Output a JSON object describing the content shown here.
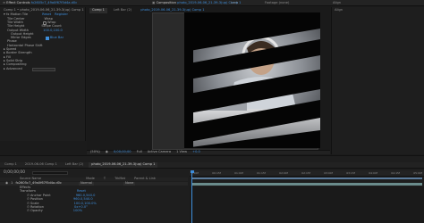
{
  "effect_controls": {
    "tab_label": "Effect Controls",
    "layer_name": "fx2605c7_49a0f67f5d4a.d0c",
    "breadcrumb": "Comp 1 • photo_2019-06-06_21-39-3(up) Comp 1",
    "reset_label": "Reset",
    "register_label": "Register",
    "effects": [
      {
        "name": "fx Motion Tile",
        "indent": 0
      },
      {
        "name": "Tile Center",
        "indent": 1
      },
      {
        "name": "Tile Width",
        "indent": 1
      },
      {
        "name": "Tile Height",
        "indent": 1
      },
      {
        "name": "Output Width",
        "indent": 1
      },
      {
        "name": "Output Height",
        "indent": 1
      },
      {
        "name": "Mirror Edges",
        "indent": 1
      },
      {
        "name": "Phase",
        "indent": 1
      },
      {
        "name": "Horizontal Phase Shift",
        "indent": 1
      },
      {
        "name": "Speed",
        "indent": 0
      },
      {
        "name": "Border Strength",
        "indent": 0
      },
      {
        "name": "Fill",
        "indent": 0
      },
      {
        "name": "Solid Strip",
        "indent": 0
      },
      {
        "name": "Compositing",
        "indent": 0
      },
      {
        "name": "Advanced",
        "indent": 0
      }
    ],
    "options": {
      "wrap_label": "Wrap",
      "line_count_label": "Stripe Count",
      "color_label": "Blue Bar",
      "value_1": "100.0,100.0",
      "value_2": "Wrap"
    }
  },
  "composition": {
    "tab_label": "Composition",
    "comp_name": "photo_2019-06-06_21-39-3(up) Comp 1",
    "tab2_label": "Lock",
    "tab3_label": "Footage (none)",
    "tab4_label": "Align",
    "sub_tabs": [
      "Comp 1",
      "Left Bar (2)",
      "photo_2019-06-06_21-39-3(up) Comp 1"
    ],
    "footer": {
      "zoom": "(50%)",
      "time": "0;00;00;00",
      "resolution": "Full",
      "camera": "Active Camera",
      "view": "1 View",
      "exposure": "+0.0"
    }
  },
  "right_panel": {
    "label": "Align"
  },
  "timeline": {
    "tabs": [
      "Comp 1",
      "2019-06-06 Comp 1",
      "Left Bar (2)",
      "photo_2019-06-06_21-39-3(up) Comp 1"
    ],
    "timecode": "0;00;00;00",
    "columns": [
      "Source Name",
      "Mode",
      "T",
      "TrkMat",
      "Parent & Link"
    ],
    "layers": [
      {
        "num": "1",
        "name": "fx2605c7_49a0f67f5d4a.d0c",
        "mode": "Normal",
        "parent": "None"
      }
    ],
    "properties": [
      {
        "name": "Effects",
        "value": ""
      },
      {
        "name": "Transform",
        "value": "Reset"
      },
      {
        "name": "Anchor Point",
        "value": "960.0,540.0"
      },
      {
        "name": "Position",
        "value": "960.0,540.0"
      },
      {
        "name": "Scale",
        "value": "100.0,100.0%"
      },
      {
        "name": "Rotation",
        "value": "0x+0.0°"
      },
      {
        "name": "Opacity",
        "value": "100%"
      }
    ],
    "ruler": [
      "0:00f",
      "00:15f",
      "01:00f",
      "01:15f",
      "02:00f",
      "02:15f",
      "03:00f",
      "03:15f",
      "04:00f",
      "04:15f",
      "05:00f"
    ],
    "colors": {
      "accent_blue": "#3e8edb",
      "work_area": "#5a7a9a",
      "layer_bar": "#6a8c8c"
    }
  }
}
